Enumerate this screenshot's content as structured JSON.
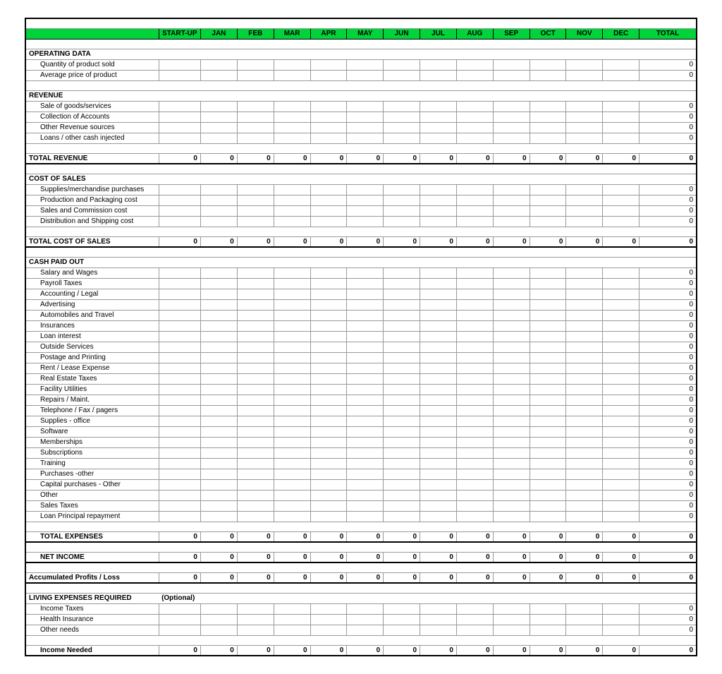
{
  "columns": [
    "START-UP",
    "JAN",
    "FEB",
    "MAR",
    "APR",
    "MAY",
    "JUN",
    "JUL",
    "AUG",
    "SEP",
    "OCT",
    "NOV",
    "DEC",
    "TOTAL"
  ],
  "sections": {
    "operating": {
      "title": "OPERATING DATA",
      "rows": [
        "Quantity of product sold",
        "Average price of product"
      ]
    },
    "revenue": {
      "title": "REVENUE",
      "rows": [
        "Sale of goods/services",
        "Collection of Accounts",
        "Other Revenue sources",
        "Loans / other cash injected"
      ],
      "total_label": "TOTAL REVENUE"
    },
    "cost_of_sales": {
      "title": "COST OF SALES",
      "rows": [
        "Supplies/merchandise purchases",
        "Production and Packaging cost",
        "Sales and Commission cost",
        "Distribution and Shipping cost"
      ],
      "total_label": "TOTAL COST OF SALES"
    },
    "cash_paid_out": {
      "title": "CASH PAID OUT",
      "rows": [
        "Salary and Wages",
        "Payroll Taxes",
        "Accounting / Legal",
        "Advertising",
        "Automobiles and Travel",
        "Insurances",
        "Loan interest",
        "Outside Services",
        "Postage and Printing",
        "Rent / Lease Expense",
        "Real Estate Taxes",
        "Facility Utilities",
        "Repairs / Maint.",
        "Telephone / Fax / pagers",
        "Supplies - office",
        "Software",
        "Memberships",
        "Subscriptions",
        "Training",
        "Purchases -other",
        "Capital purchases - Other",
        "Other",
        "Sales Taxes",
        "Loan Principal repayment"
      ],
      "total_label": "TOTAL EXPENSES"
    },
    "net_income": "NET INCOME",
    "accum": "Accumulated Profits / Loss",
    "living": {
      "title": "LIVING EXPENSES REQUIRED",
      "note": "(Optional)",
      "rows": [
        "Income Taxes",
        "Health Insurance",
        "Other needs"
      ],
      "total_label": "Income Needed"
    }
  },
  "zero": "0",
  "chart_data": {
    "type": "table",
    "title": "Cash-flow / income worksheet",
    "columns": [
      "START-UP",
      "JAN",
      "FEB",
      "MAR",
      "APR",
      "MAY",
      "JUN",
      "JUL",
      "AUG",
      "SEP",
      "OCT",
      "NOV",
      "DEC",
      "TOTAL"
    ],
    "rows": {
      "Quantity of product sold": [
        null,
        null,
        null,
        null,
        null,
        null,
        null,
        null,
        null,
        null,
        null,
        null,
        null,
        0
      ],
      "Average price of product": [
        null,
        null,
        null,
        null,
        null,
        null,
        null,
        null,
        null,
        null,
        null,
        null,
        null,
        0
      ],
      "Sale of goods/services": [
        null,
        null,
        null,
        null,
        null,
        null,
        null,
        null,
        null,
        null,
        null,
        null,
        null,
        0
      ],
      "Collection of Accounts": [
        null,
        null,
        null,
        null,
        null,
        null,
        null,
        null,
        null,
        null,
        null,
        null,
        null,
        0
      ],
      "Other Revenue sources": [
        null,
        null,
        null,
        null,
        null,
        null,
        null,
        null,
        null,
        null,
        null,
        null,
        null,
        0
      ],
      "Loans / other cash injected": [
        null,
        null,
        null,
        null,
        null,
        null,
        null,
        null,
        null,
        null,
        null,
        null,
        null,
        0
      ],
      "TOTAL REVENUE": [
        0,
        0,
        0,
        0,
        0,
        0,
        0,
        0,
        0,
        0,
        0,
        0,
        0,
        0
      ],
      "Supplies/merchandise purchases": [
        null,
        null,
        null,
        null,
        null,
        null,
        null,
        null,
        null,
        null,
        null,
        null,
        null,
        0
      ],
      "Production and Packaging cost": [
        null,
        null,
        null,
        null,
        null,
        null,
        null,
        null,
        null,
        null,
        null,
        null,
        null,
        0
      ],
      "Sales and Commission cost": [
        null,
        null,
        null,
        null,
        null,
        null,
        null,
        null,
        null,
        null,
        null,
        null,
        null,
        0
      ],
      "Distribution and Shipping cost": [
        null,
        null,
        null,
        null,
        null,
        null,
        null,
        null,
        null,
        null,
        null,
        null,
        null,
        0
      ],
      "TOTAL COST OF SALES": [
        0,
        0,
        0,
        0,
        0,
        0,
        0,
        0,
        0,
        0,
        0,
        0,
        0,
        0
      ],
      "Salary and Wages": [
        null,
        null,
        null,
        null,
        null,
        null,
        null,
        null,
        null,
        null,
        null,
        null,
        null,
        0
      ],
      "Payroll Taxes": [
        null,
        null,
        null,
        null,
        null,
        null,
        null,
        null,
        null,
        null,
        null,
        null,
        null,
        0
      ],
      "Accounting / Legal": [
        null,
        null,
        null,
        null,
        null,
        null,
        null,
        null,
        null,
        null,
        null,
        null,
        null,
        0
      ],
      "Advertising": [
        null,
        null,
        null,
        null,
        null,
        null,
        null,
        null,
        null,
        null,
        null,
        null,
        null,
        0
      ],
      "Automobiles and Travel": [
        null,
        null,
        null,
        null,
        null,
        null,
        null,
        null,
        null,
        null,
        null,
        null,
        null,
        0
      ],
      "Insurances": [
        null,
        null,
        null,
        null,
        null,
        null,
        null,
        null,
        null,
        null,
        null,
        null,
        null,
        0
      ],
      "Loan interest": [
        null,
        null,
        null,
        null,
        null,
        null,
        null,
        null,
        null,
        null,
        null,
        null,
        null,
        0
      ],
      "Outside Services": [
        null,
        null,
        null,
        null,
        null,
        null,
        null,
        null,
        null,
        null,
        null,
        null,
        null,
        0
      ],
      "Postage and Printing": [
        null,
        null,
        null,
        null,
        null,
        null,
        null,
        null,
        null,
        null,
        null,
        null,
        null,
        0
      ],
      "Rent / Lease Expense": [
        null,
        null,
        null,
        null,
        null,
        null,
        null,
        null,
        null,
        null,
        null,
        null,
        null,
        0
      ],
      "Real Estate Taxes": [
        null,
        null,
        null,
        null,
        null,
        null,
        null,
        null,
        null,
        null,
        null,
        null,
        null,
        0
      ],
      "Facility Utilities": [
        null,
        null,
        null,
        null,
        null,
        null,
        null,
        null,
        null,
        null,
        null,
        null,
        null,
        0
      ],
      "Repairs / Maint.": [
        null,
        null,
        null,
        null,
        null,
        null,
        null,
        null,
        null,
        null,
        null,
        null,
        null,
        0
      ],
      "Telephone / Fax / pagers": [
        null,
        null,
        null,
        null,
        null,
        null,
        null,
        null,
        null,
        null,
        null,
        null,
        null,
        0
      ],
      "Supplies - office": [
        null,
        null,
        null,
        null,
        null,
        null,
        null,
        null,
        null,
        null,
        null,
        null,
        null,
        0
      ],
      "Software": [
        null,
        null,
        null,
        null,
        null,
        null,
        null,
        null,
        null,
        null,
        null,
        null,
        null,
        0
      ],
      "Memberships": [
        null,
        null,
        null,
        null,
        null,
        null,
        null,
        null,
        null,
        null,
        null,
        null,
        null,
        0
      ],
      "Subscriptions": [
        null,
        null,
        null,
        null,
        null,
        null,
        null,
        null,
        null,
        null,
        null,
        null,
        null,
        0
      ],
      "Training": [
        null,
        null,
        null,
        null,
        null,
        null,
        null,
        null,
        null,
        null,
        null,
        null,
        null,
        0
      ],
      "Purchases -other": [
        null,
        null,
        null,
        null,
        null,
        null,
        null,
        null,
        null,
        null,
        null,
        null,
        null,
        0
      ],
      "Capital purchases - Other": [
        null,
        null,
        null,
        null,
        null,
        null,
        null,
        null,
        null,
        null,
        null,
        null,
        null,
        0
      ],
      "Other": [
        null,
        null,
        null,
        null,
        null,
        null,
        null,
        null,
        null,
        null,
        null,
        null,
        null,
        0
      ],
      "Sales Taxes": [
        null,
        null,
        null,
        null,
        null,
        null,
        null,
        null,
        null,
        null,
        null,
        null,
        null,
        0
      ],
      "Loan Principal repayment": [
        null,
        null,
        null,
        null,
        null,
        null,
        null,
        null,
        null,
        null,
        null,
        null,
        null,
        0
      ],
      "TOTAL EXPENSES": [
        0,
        0,
        0,
        0,
        0,
        0,
        0,
        0,
        0,
        0,
        0,
        0,
        0,
        0
      ],
      "NET INCOME": [
        0,
        0,
        0,
        0,
        0,
        0,
        0,
        0,
        0,
        0,
        0,
        0,
        0,
        0
      ],
      "Accumulated Profits / Loss": [
        0,
        0,
        0,
        0,
        0,
        0,
        0,
        0,
        0,
        0,
        0,
        0,
        0,
        0
      ],
      "Income Taxes": [
        null,
        null,
        null,
        null,
        null,
        null,
        null,
        null,
        null,
        null,
        null,
        null,
        null,
        0
      ],
      "Health Insurance": [
        null,
        null,
        null,
        null,
        null,
        null,
        null,
        null,
        null,
        null,
        null,
        null,
        null,
        0
      ],
      "Other needs": [
        null,
        null,
        null,
        null,
        null,
        null,
        null,
        null,
        null,
        null,
        null,
        null,
        null,
        0
      ],
      "Income Needed": [
        0,
        0,
        0,
        0,
        0,
        0,
        0,
        0,
        0,
        0,
        0,
        0,
        0,
        0
      ]
    }
  }
}
